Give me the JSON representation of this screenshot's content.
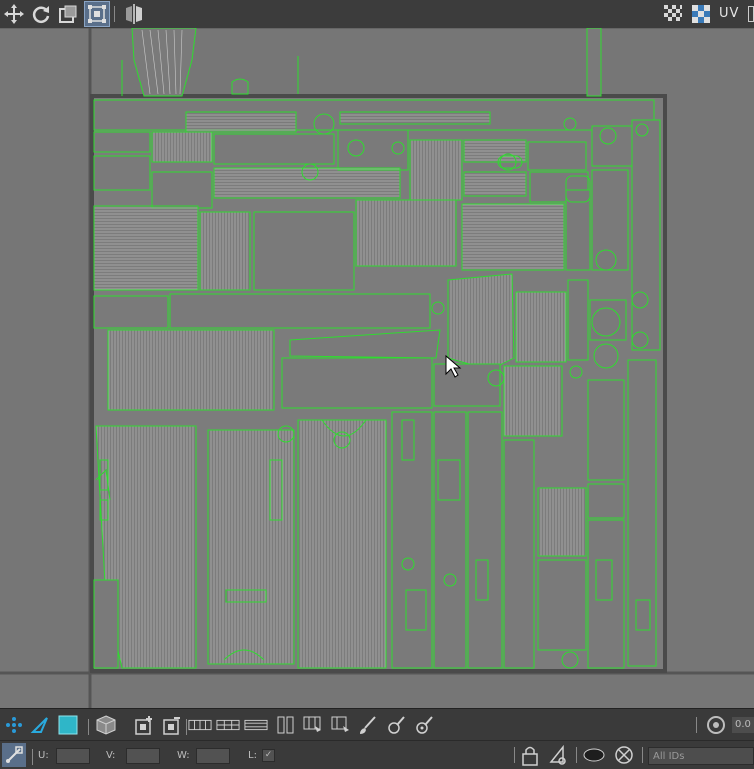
{
  "toolbar": {
    "uv_label": "UV"
  },
  "bottom_toolbar": {
    "u_label": "U:",
    "v_label": "V:",
    "w_label": "W:",
    "l_label": "L:",
    "id_filter": "All IDs",
    "value_field": "0.0"
  },
  "colors": {
    "uv_edge": "#2fdc2f",
    "uv_wire": "#c9c9c9",
    "uv_face": "#7c7c7c",
    "viewport_bg": "#767676",
    "toolbar_bg": "#3c3c3c",
    "active_button": "#5a6f8a"
  },
  "icons": {
    "top": [
      "move-icon",
      "rotate-icon",
      "scale-icon",
      "freeform-icon",
      "mirror-icon",
      "checker-icon",
      "texture-icon"
    ],
    "bottom": [
      "vertex-select-icon",
      "edge-select-icon",
      "face-select-icon",
      "element-cube-icon",
      "grow-icon",
      "shrink-icon",
      "loop-icon",
      "ring-icon",
      "brush-icon",
      "pin-icon",
      "relax-icon",
      "lock-icon",
      "paint-select-icon",
      "show-icon",
      "filter-icon",
      "snap-icon"
    ]
  }
}
